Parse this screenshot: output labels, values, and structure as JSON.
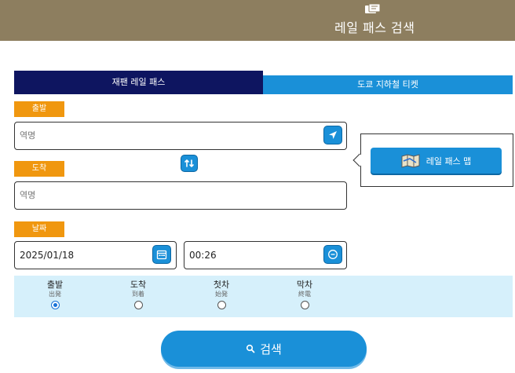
{
  "header": {
    "title": "레일 패스 검색",
    "icon": "ticket-icon"
  },
  "tabs": [
    {
      "label": "재팬 레일 패스",
      "active": true
    },
    {
      "label": "도쿄 지하철 티켓",
      "active": false
    }
  ],
  "departure": {
    "label": "출발",
    "placeholder": "역명"
  },
  "arrival": {
    "label": "도착",
    "placeholder": "역명"
  },
  "date": {
    "label": "날짜",
    "value": "2025/01/18",
    "time": "00:26"
  },
  "map_button": {
    "label": "레일 패스 맵"
  },
  "time_options": [
    {
      "label": "출발",
      "sub": "出発",
      "checked": true
    },
    {
      "label": "도착",
      "sub": "到着",
      "checked": false
    },
    {
      "label": "첫차",
      "sub": "始発",
      "checked": false
    },
    {
      "label": "막차",
      "sub": "終電",
      "checked": false
    }
  ],
  "search_button": {
    "label": "검색"
  },
  "colors": {
    "header": "#8d7e5f",
    "primary": "#1a90d8",
    "tab_active": "#0e1560",
    "label": "#f0970f",
    "radio_bar": "#d6f0fb"
  }
}
